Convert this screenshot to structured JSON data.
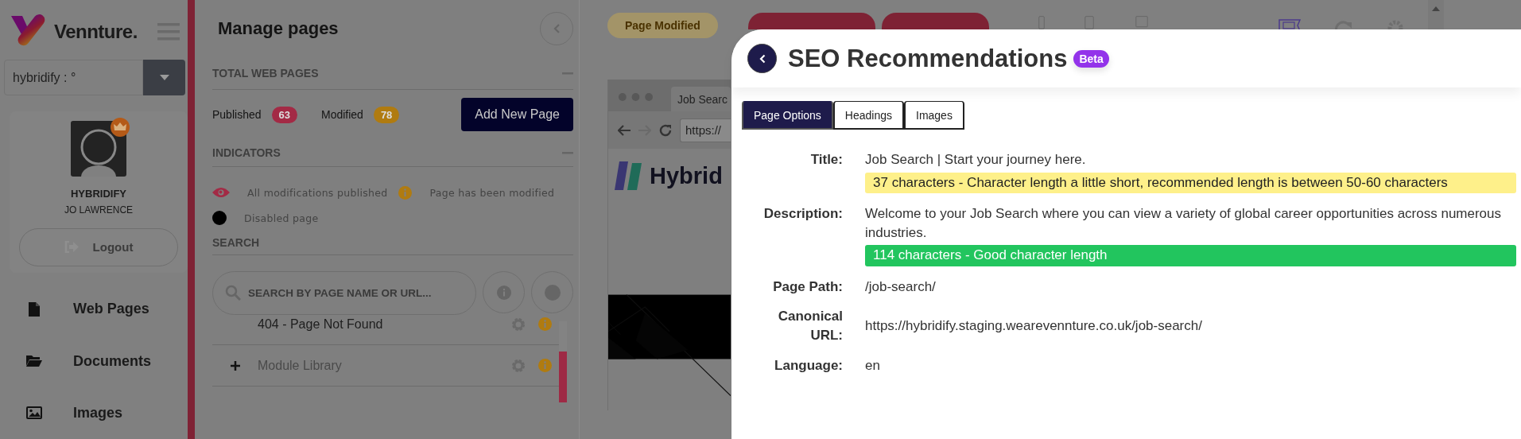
{
  "sidebar": {
    "brand": "Vennture.",
    "site_select": {
      "value": "hybridify : °"
    },
    "profile": {
      "company": "HYBRIDIFY",
      "name": "JO LAWRENCE",
      "logout": "Logout"
    },
    "nav": [
      {
        "label": "Web Pages"
      },
      {
        "label": "Documents"
      },
      {
        "label": "Images"
      }
    ]
  },
  "pages_panel": {
    "title": "Manage pages",
    "total_heading": "TOTAL WEB PAGES",
    "stats": [
      {
        "label": "Published",
        "count": "63",
        "color": "#a32a45"
      },
      {
        "label": "Modified",
        "count": "78",
        "color": "#b07b10"
      }
    ],
    "add_button": "Add New Page",
    "indicators_heading": "INDICATORS",
    "indicators": [
      {
        "kind": "eye",
        "label": "All modifications published"
      },
      {
        "kind": "info",
        "label": "Page has been modified"
      },
      {
        "kind": "dot",
        "label": "Disabled page"
      }
    ],
    "search_heading": "SEARCH",
    "search": {
      "placeholder": "SEARCH BY PAGE NAME OR URL..."
    },
    "pages": [
      {
        "name": "404 - Page Not Found",
        "expandable": false,
        "disabled": false
      },
      {
        "name": "Module Library",
        "expandable": true,
        "disabled": true
      }
    ]
  },
  "toolbar": {
    "status": "Page Modified"
  },
  "preview": {
    "tab": "Job Searc",
    "address": "https://",
    "logo": "Hybrid"
  },
  "seo": {
    "title": "SEO Recommendations",
    "badge": "Beta",
    "tabs": [
      {
        "label": "Page Options",
        "selected": true
      },
      {
        "label": "Headings",
        "selected": false
      },
      {
        "label": "Images",
        "selected": false
      }
    ],
    "fields": [
      {
        "label": "Title:",
        "value": "Job Search | Start your journey here.",
        "note": {
          "text": "37 characters - Character length a little short, recommended length is between 50-60 characters",
          "kind": "warning"
        }
      },
      {
        "label": "Description:",
        "value": "Welcome to your Job Search where you can view a variety of global career opportunities across numerous industries.",
        "note": {
          "text": "114 characters - Good character length",
          "kind": "good"
        }
      },
      {
        "label": "Page Path:",
        "value": "/job-search/"
      },
      {
        "label": "Canonical URL:",
        "value": "https://hybridify.staging.wearevennture.co.uk/job-search/"
      },
      {
        "label": "Language:",
        "value": "en"
      }
    ]
  }
}
